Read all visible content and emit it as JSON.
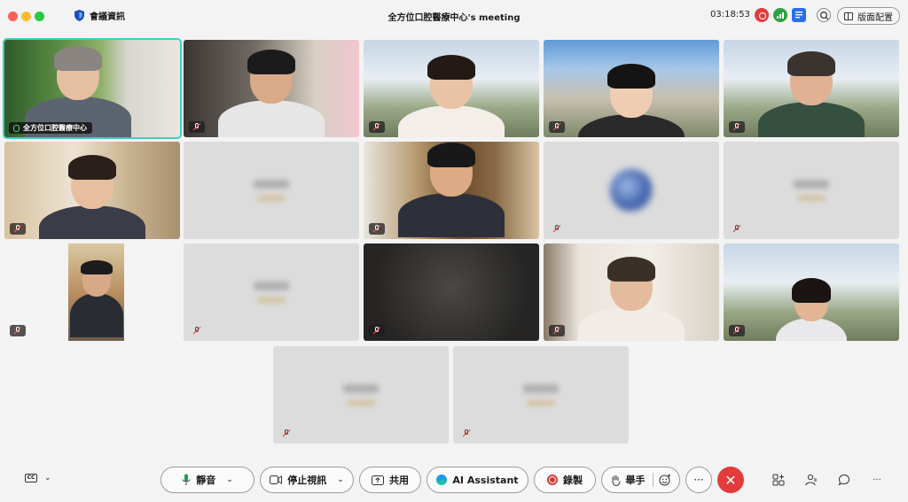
{
  "window": {
    "meeting_info_label": "會議資訊",
    "title": "全方位口腔醫療中心's meeting",
    "timer": "03:18:53",
    "layout_label": "版面配置"
  },
  "tiles": {
    "host_name": "全方位口腔醫療中心"
  },
  "toolbar": {
    "cc_label": "CC",
    "mute_label": "靜音",
    "stop_video_label": "停止視訊",
    "share_label": "共用",
    "ai_label": "AI Assistant",
    "record_label": "錄製",
    "raise_hand_label": "舉手",
    "more_label": "···",
    "end_label": "✕"
  },
  "colors": {
    "active_border": "#3bd1bf",
    "end_call": "#e33b3b",
    "record": "#d13b3b"
  }
}
